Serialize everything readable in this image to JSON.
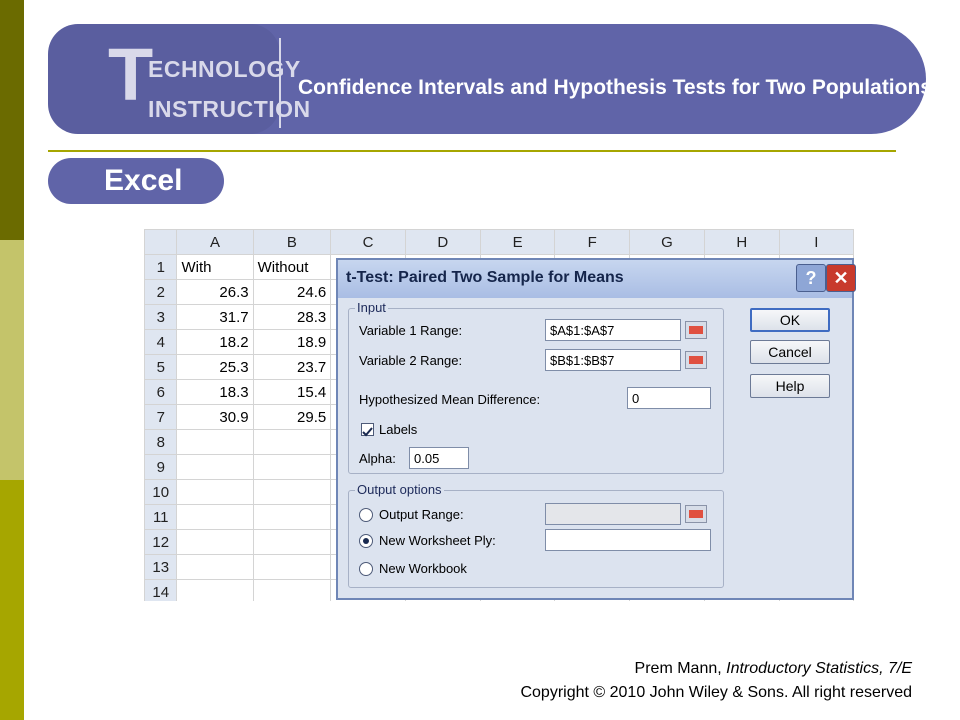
{
  "banner": {
    "logo_letter": "T",
    "logo_line1": "ECHNOLOGY",
    "logo_line2": "INSTRUCTION",
    "title": "Confidence Intervals and Hypothesis Tests for Two Populations"
  },
  "section_tab": "Excel",
  "spreadsheet": {
    "columns": [
      "A",
      "B",
      "C",
      "D",
      "E",
      "F",
      "G",
      "H",
      "I"
    ],
    "rows": [
      {
        "n": "1",
        "a": "With",
        "b": "Without"
      },
      {
        "n": "2",
        "a": "26.3",
        "b": "24.6"
      },
      {
        "n": "3",
        "a": "31.7",
        "b": "28.3"
      },
      {
        "n": "4",
        "a": "18.2",
        "b": "18.9"
      },
      {
        "n": "5",
        "a": "25.3",
        "b": "23.7"
      },
      {
        "n": "6",
        "a": "18.3",
        "b": "15.4"
      },
      {
        "n": "7",
        "a": "30.9",
        "b": "29.5"
      },
      {
        "n": "8",
        "a": "",
        "b": ""
      },
      {
        "n": "9",
        "a": "",
        "b": ""
      },
      {
        "n": "10",
        "a": "",
        "b": ""
      },
      {
        "n": "11",
        "a": "",
        "b": ""
      },
      {
        "n": "12",
        "a": "",
        "b": ""
      },
      {
        "n": "13",
        "a": "",
        "b": ""
      },
      {
        "n": "14",
        "a": "",
        "b": ""
      }
    ]
  },
  "dialog": {
    "title": "t-Test: Paired Two Sample for Means",
    "help_glyph": "?",
    "close_glyph": "✕",
    "input_group": "Input",
    "var1_label": "Variable 1 Range:",
    "var1_value": "$A$1:$A$7",
    "var2_label": "Variable 2 Range:",
    "var2_value": "$B$1:$B$7",
    "hyp_label": "Hypothesized Mean Difference:",
    "hyp_value": "0",
    "labels_label": "Labels",
    "labels_checked": true,
    "alpha_label": "Alpha:",
    "alpha_value": "0.05",
    "output_group": "Output options",
    "opt_output_range": "Output Range:",
    "opt_new_ply": "New Worksheet Ply:",
    "opt_new_workbook": "New Workbook",
    "selected_option": "New Worksheet Ply:",
    "ok": "OK",
    "cancel": "Cancel",
    "help": "Help"
  },
  "footer": {
    "author": "Prem Mann, ",
    "book": "Introductory Statistics, 7/E",
    "copyright": "Copyright © 2010 John Wiley & Sons. All right reserved"
  },
  "colors": {
    "banner": "#6064a8",
    "left_bar_dark": "#6b6b00",
    "left_bar_light": "#c4c46a",
    "left_bar_mid": "#a6a600"
  }
}
